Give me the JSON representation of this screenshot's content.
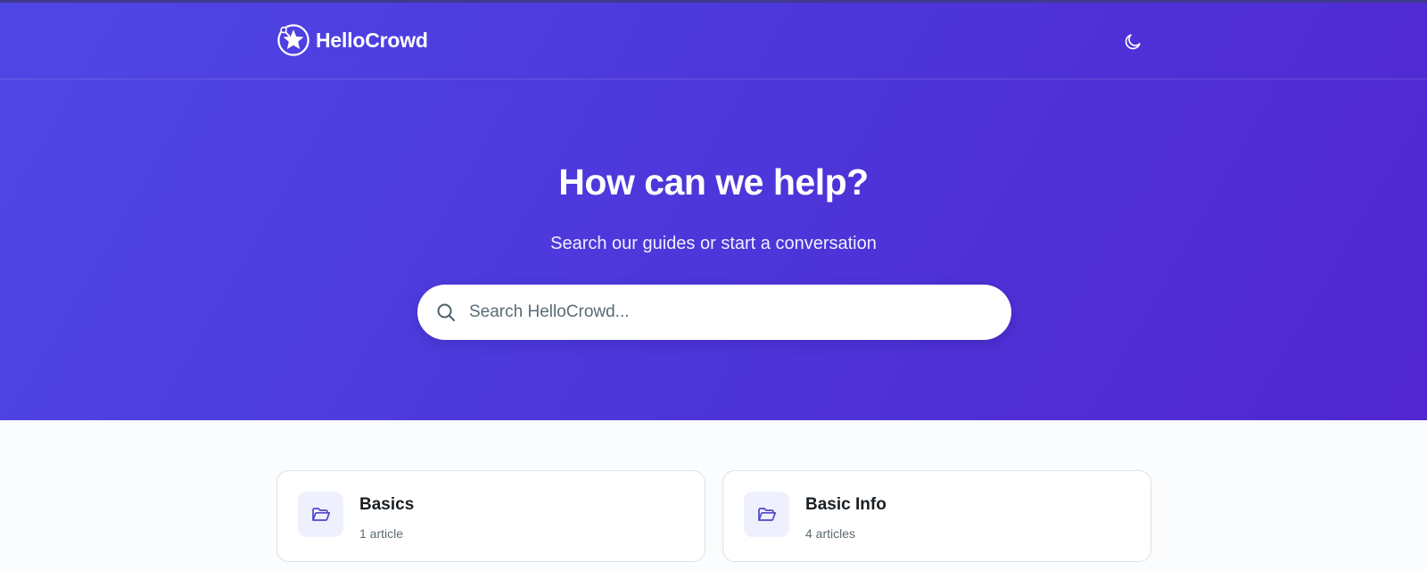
{
  "header": {
    "brand_name": "HelloCrowd",
    "logo_icon": "hellocrowd-star-logo",
    "theme_toggle_icon": "moon-icon"
  },
  "hero": {
    "title": "How can we help?",
    "subtitle": "Search our guides or start a conversation",
    "search": {
      "placeholder": "Search HelloCrowd...",
      "value": "",
      "icon": "search-icon"
    }
  },
  "categories": [
    {
      "title": "Basics",
      "count": "1 article",
      "icon": "folder-open-icon"
    },
    {
      "title": "Basic Info",
      "count": "4 articles",
      "icon": "folder-open-icon"
    }
  ],
  "colors": {
    "hero_start": "#4f46e5",
    "hero_end": "#5127cf",
    "card_icon_bg": "#eef0fd",
    "card_icon_stroke": "#4f46c8"
  }
}
